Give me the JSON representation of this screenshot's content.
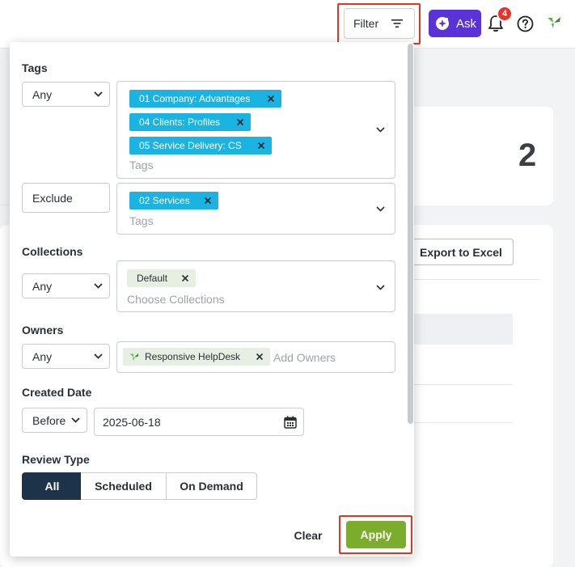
{
  "header": {
    "filter_label": "Filter",
    "ask_label": "Ask",
    "notification_count": "4",
    "brand_icon": "responsive-leaf-icon",
    "accent_color": "#5a33d6"
  },
  "background": {
    "stat_number": "2",
    "export_label": "Export to Excel"
  },
  "filter_panel": {
    "tags": {
      "label": "Tags",
      "include_mode": "Any",
      "include_chips": [
        "01 Company: Advantages",
        "04 Clients: Profiles",
        "05 Service Delivery: CS"
      ],
      "include_placeholder": "Tags",
      "exclude_mode": "Exclude",
      "exclude_chips": [
        "02 Services"
      ],
      "exclude_placeholder": "Tags",
      "chip_color": "#1bb4e2"
    },
    "collections": {
      "label": "Collections",
      "mode": "Any",
      "chips": [
        "Default"
      ],
      "placeholder": "Choose Collections"
    },
    "owners": {
      "label": "Owners",
      "mode": "Any",
      "chips": [
        "Responsive HelpDesk"
      ],
      "placeholder": "Add Owners"
    },
    "created_date": {
      "label": "Created Date",
      "mode": "Before",
      "value": "2025-06-18"
    },
    "review_type": {
      "label": "Review Type",
      "options": [
        "All",
        "Scheduled",
        "On Demand"
      ],
      "selected": "All"
    },
    "actions": {
      "clear_label": "Clear",
      "apply_label": "Apply",
      "apply_color": "#7cac2b"
    }
  }
}
